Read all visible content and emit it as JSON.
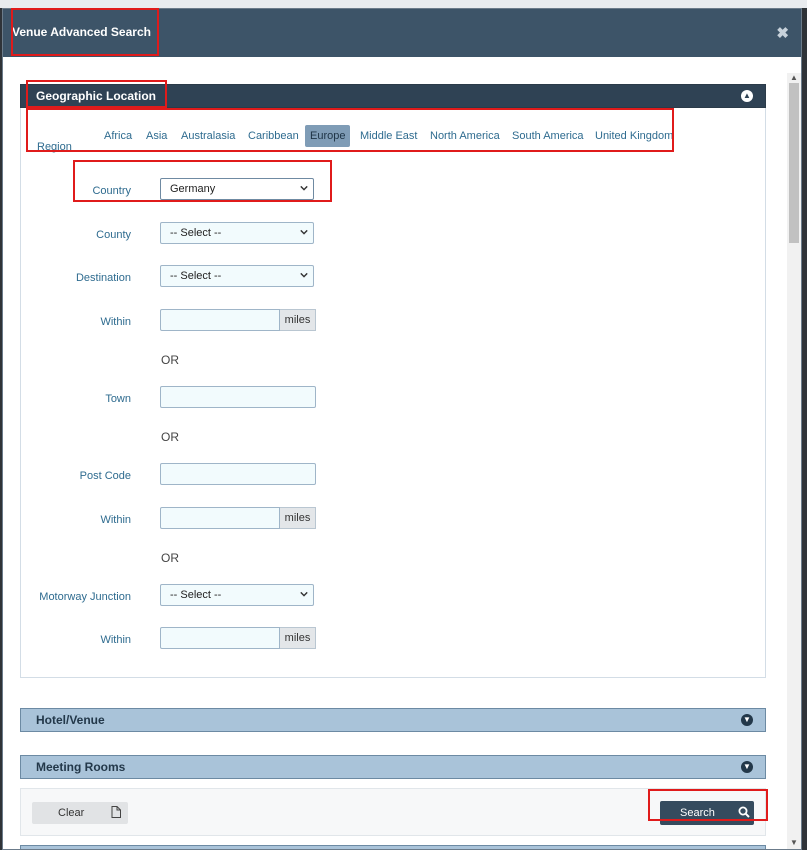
{
  "modal": {
    "title": "Venue Advanced Search",
    "close_icon": "close-icon"
  },
  "geo": {
    "title": "Geographic Location",
    "region_label": "Region",
    "regions": [
      "Africa",
      "Asia",
      "Australasia",
      "Caribbean",
      "Europe",
      "Middle East",
      "North America",
      "South America",
      "United Kingdom"
    ],
    "active_region": "Europe",
    "country_label": "Country",
    "country_value": "Germany",
    "county_label": "County",
    "county_value": "-- Select --",
    "destination_label": "Destination",
    "destination_value": "-- Select --",
    "within_label": "Within",
    "miles": "miles",
    "or": "OR",
    "town_label": "Town",
    "postcode_label": "Post Code",
    "junction_label": "Motorway Junction",
    "junction_value": "-- Select --"
  },
  "panels": {
    "hotel": "Hotel/Venue",
    "rooms": "Meeting Rooms"
  },
  "actions": {
    "clear": "Clear",
    "search": "Search"
  }
}
